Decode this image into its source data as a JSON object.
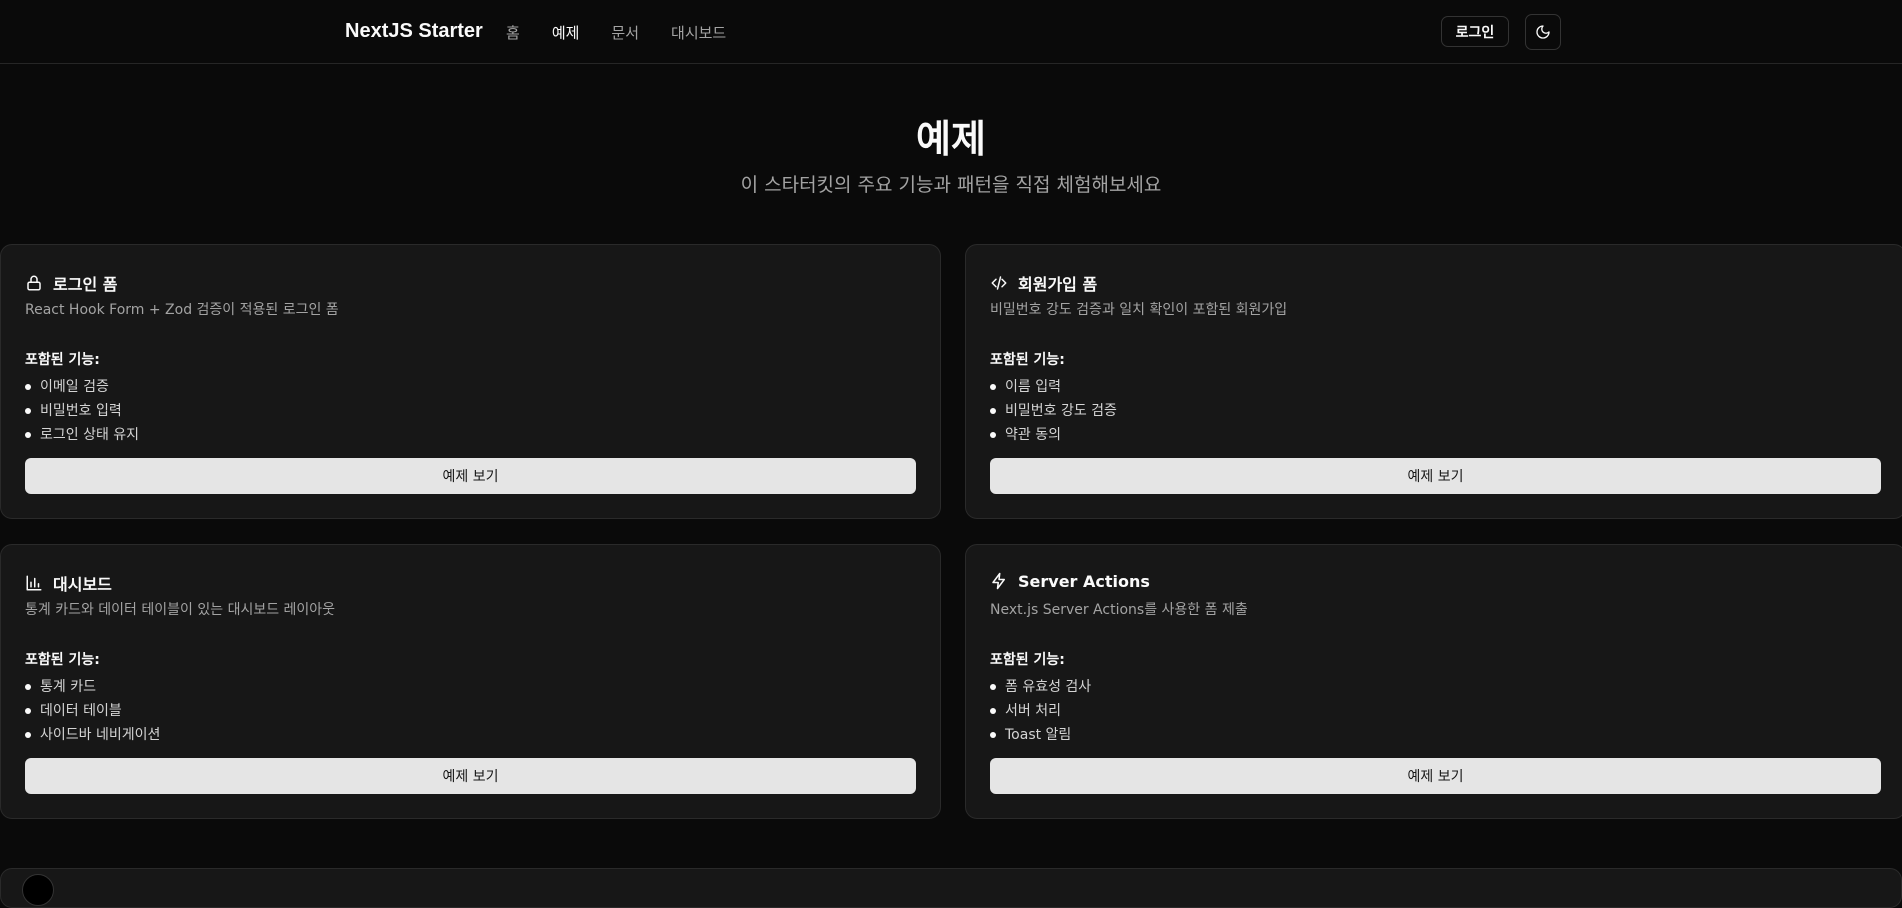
{
  "header": {
    "brand": "NextJS Starter",
    "nav": [
      {
        "label": "홈",
        "active": false
      },
      {
        "label": "예제",
        "active": true
      },
      {
        "label": "문서",
        "active": false
      },
      {
        "label": "대시보드",
        "active": false
      }
    ],
    "login_label": "로그인",
    "theme_icon": "moon-icon"
  },
  "hero": {
    "title": "예제",
    "subtitle": "이 스타터킷의 주요 기능과 패턴을 직접 체험해보세요"
  },
  "cards": [
    {
      "icon": "lock-icon",
      "title": "로그인 폼",
      "description": "React Hook Form + Zod 검증이 적용된 로그인 폼",
      "features_heading": "포함된 기능:",
      "features": [
        "이메일 검증",
        "비밀번호 입력",
        "로그인 상태 유지"
      ],
      "button": "예제 보기"
    },
    {
      "icon": "code-icon",
      "title": "회원가입 폼",
      "description": "비밀번호 강도 검증과 일치 확인이 포함된 회원가입",
      "features_heading": "포함된 기능:",
      "features": [
        "이름 입력",
        "비밀번호 강도 검증",
        "약관 동의"
      ],
      "button": "예제 보기"
    },
    {
      "icon": "bar-chart-icon",
      "title": "대시보드",
      "description": "통계 카드와 데이터 테이블이 있는 대시보드 레이아웃",
      "features_heading": "포함된 기능:",
      "features": [
        "통계 카드",
        "데이터 테이블",
        "사이드바 네비게이션"
      ],
      "button": "예제 보기"
    },
    {
      "icon": "zap-icon",
      "title": "Server Actions",
      "description": "Next.js Server Actions를 사용한 폼 제출",
      "features_heading": "포함된 기능:",
      "features": [
        "폼 유효성 검사",
        "서버 처리",
        "Toast 알림"
      ],
      "button": "예제 보기"
    }
  ]
}
